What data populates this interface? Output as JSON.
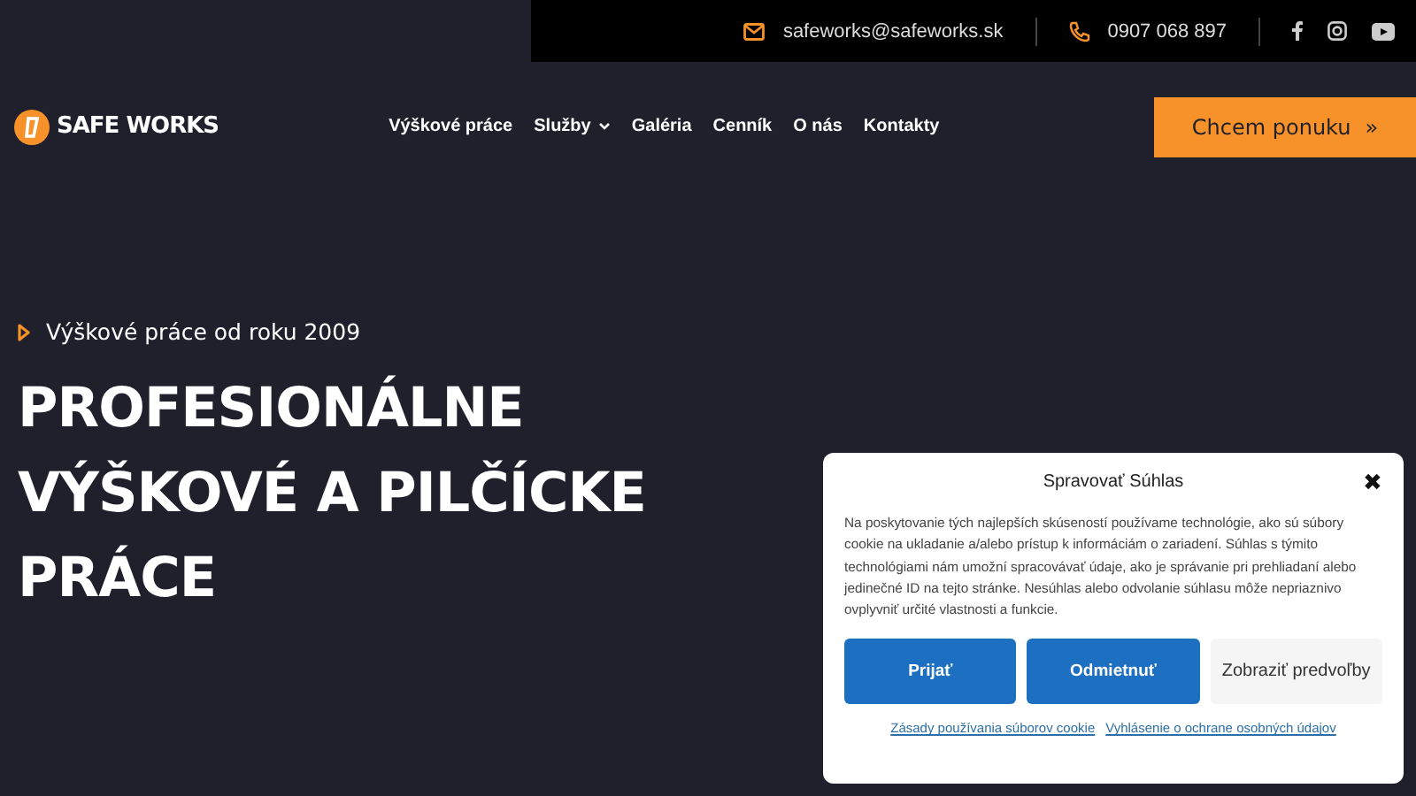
{
  "topbar": {
    "email": "safeworks@safeworks.sk",
    "phone": "0907 068 897"
  },
  "header": {
    "logo": "SAFE WORKS",
    "nav": [
      {
        "label": "Výškové práce",
        "has_submenu": false
      },
      {
        "label": "Služby",
        "has_submenu": true
      },
      {
        "label": "Galéria",
        "has_submenu": false
      },
      {
        "label": "Cenník",
        "has_submenu": false
      },
      {
        "label": "O nás",
        "has_submenu": false
      },
      {
        "label": "Kontakty",
        "has_submenu": false
      }
    ],
    "cta": "Chcem ponuku",
    "cta_icon": "»"
  },
  "hero": {
    "tagline": "Výškové práce od roku 2009",
    "title_lines": [
      "PROFESIONÁLNE",
      "VÝŠKOVÉ A PILČÍCKE",
      "PRÁCE"
    ]
  },
  "cookie_dialog": {
    "title": "Spravovať Súhlas",
    "close": "✖",
    "text": "Na poskytovanie tých najlepších skúseností používame technológie, ako sú súbory cookie na ukladanie a/alebo prístup k informáciám o zariadení. Súhlas s týmito technológiami nám umožní spracovávať údaje, ako je správanie pri prehliadaní alebo jedinečné ID na tejto stránke. Nesúhlas alebo odvolanie súhlasu môže nepriaznivo ovplyvniť určité vlastnosti a funkcie.",
    "buttons": [
      {
        "label": "Prijať",
        "kind": "primary"
      },
      {
        "label": "Odmietnuť",
        "kind": "primary"
      },
      {
        "label": "Zobraziť predvoľby",
        "kind": "secondary"
      }
    ],
    "links": [
      "Zásady používania súborov cookie",
      "Vyhlásenie o ochrane osobných údajov"
    ]
  }
}
